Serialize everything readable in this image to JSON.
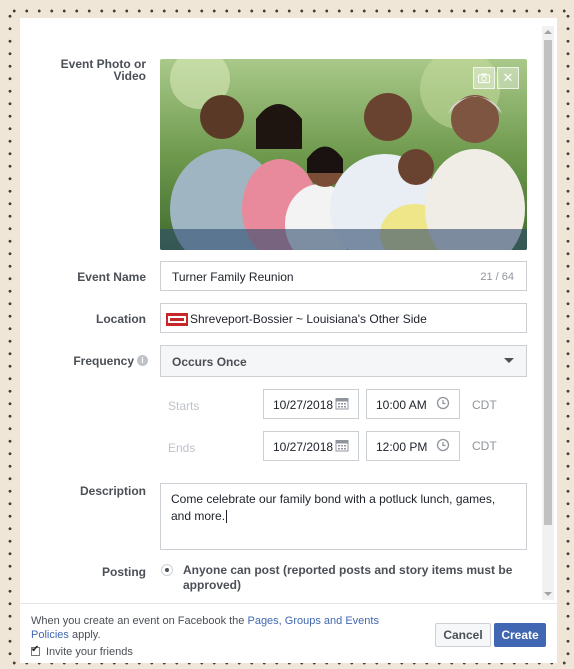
{
  "form": {
    "photo_label": "Event Photo or Video",
    "event_name_label": "Event Name",
    "event_name_value": "Turner Family Reunion",
    "event_name_counter": "21 / 64",
    "location_label": "Location",
    "location_value": "Shreveport-Bossier ~ Louisiana's Other Side",
    "frequency_label": "Frequency",
    "frequency_value": "Occurs Once",
    "starts_label": "Starts",
    "start_date": "10/27/2018",
    "start_time": "10:00 AM",
    "ends_label": "Ends",
    "end_date": "10/27/2018",
    "end_time": "12:00 PM",
    "timezone": "CDT",
    "description_label": "Description",
    "description_value": "Come celebrate our family bond with a potluck lunch, games, and more.",
    "posting_label": "Posting",
    "posting_option": "Anyone can post (reported posts and story items must be approved)"
  },
  "footer": {
    "notice_prefix": "When you create an event on Facebook the ",
    "notice_link": "Pages, Groups and Events Policies",
    "notice_suffix": " apply.",
    "invite_label": "Invite your friends",
    "cancel_label": "Cancel",
    "create_label": "Create"
  },
  "colors": {
    "accent": "#4267b2",
    "border": "#ccd0d5",
    "background": "#efe6d8"
  },
  "icons": [
    "camera-icon",
    "close-icon",
    "info-icon",
    "calendar-icon",
    "clock-icon",
    "location-logo-icon",
    "chevron-down-icon",
    "checkbox-icon"
  ]
}
